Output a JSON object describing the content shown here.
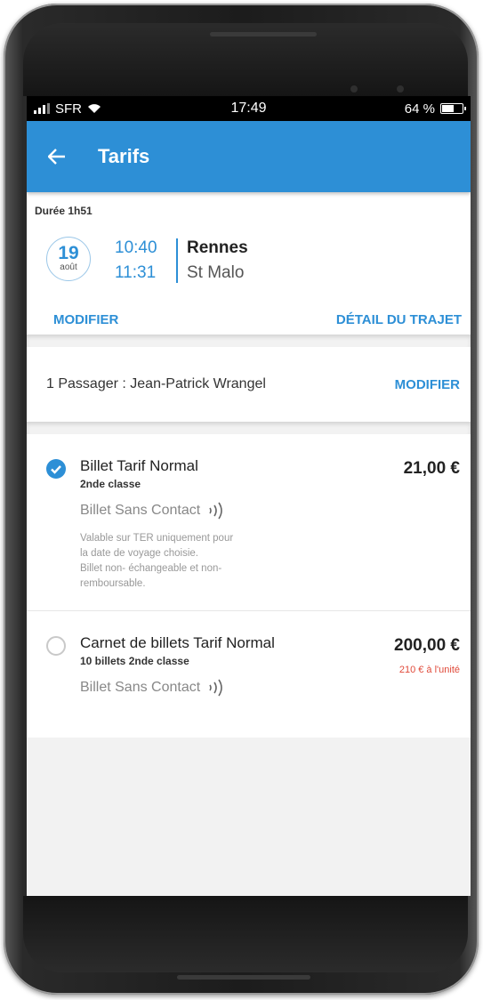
{
  "status": {
    "carrier": "SFR",
    "time": "17:49",
    "battery": "64 %",
    "battery_level": 0.64
  },
  "appbar": {
    "title": "Tarifs",
    "back_icon": "arrow-left-icon"
  },
  "trip": {
    "duration": "Durée 1h51",
    "day": "19",
    "month": "août",
    "departure_time": "10:40",
    "arrival_time": "11:31",
    "from": "Rennes",
    "to": "St Malo",
    "modify_label": "MODIFIER",
    "details_label": "DÉTAIL DU TRAJET"
  },
  "passenger": {
    "text": "1 Passager : Jean-Patrick Wrangel",
    "modify_label": "MODIFIER"
  },
  "offers": [
    {
      "selected": true,
      "title": "Billet Tarif Normal",
      "subtitle": "2nde classe",
      "contact": "Billet Sans Contact",
      "note1": "Valable sur TER uniquement pour",
      "note2": "la date de voyage choisie.",
      "note3": "Billet non- échangeable et non-",
      "note4": "remboursable.",
      "price": "21,00 €",
      "unit": ""
    },
    {
      "selected": false,
      "title": "Carnet de billets Tarif Normal",
      "subtitle": "10 billets 2nde classe",
      "contact": "Billet Sans Contact",
      "price": "200,00 €",
      "unit": "210 € à l'unité"
    }
  ],
  "colors": {
    "accent": "#2d8fd6",
    "unit_price": "#e04a3a"
  }
}
